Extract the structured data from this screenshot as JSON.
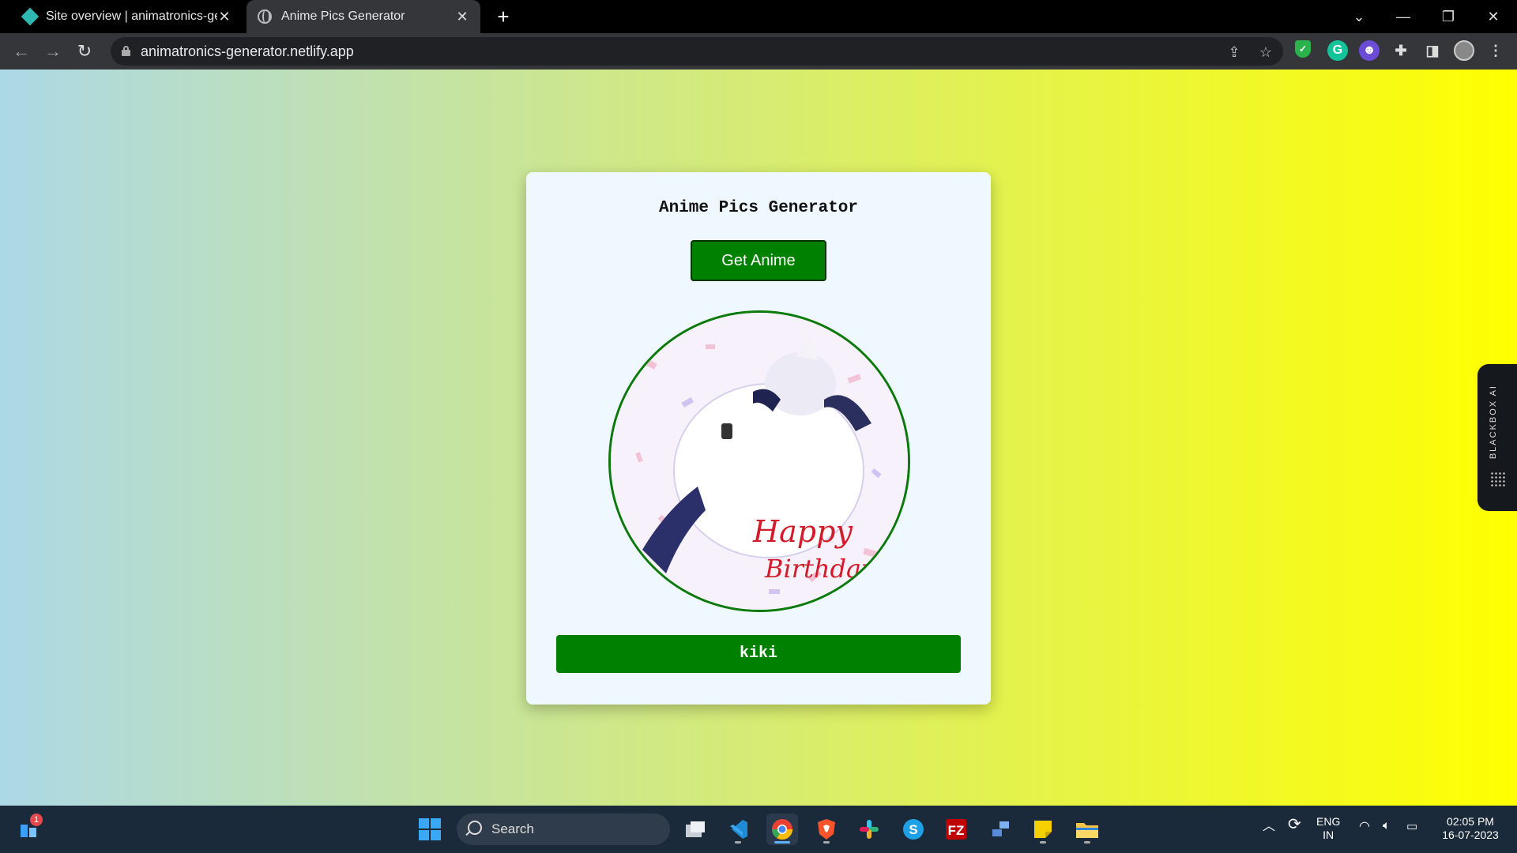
{
  "browser": {
    "tabs": [
      {
        "title": "Site overview | animatronics-gen",
        "icon": "netlify-diamond-icon"
      },
      {
        "title": "Anime Pics Generator",
        "icon": "globe-icon",
        "active": true
      }
    ],
    "url": "animatronics-generator.netlify.app"
  },
  "page": {
    "heading": "Anime Pics Generator",
    "button_label": "Get Anime",
    "image_alt": "anime character sleeping with Happy Birthday text",
    "image_text": "Happy Birthday",
    "name": "kiki",
    "background_gradient": [
      "#add8e6",
      "#ffff00"
    ],
    "accent": "#008000"
  },
  "sidebar_widget": {
    "label": "BLACKBOX AI"
  },
  "taskbar": {
    "search_placeholder": "Search",
    "notification_count": "1",
    "language": "ENG",
    "region": "IN",
    "time": "02:05 PM",
    "date": "16-07-2023"
  }
}
